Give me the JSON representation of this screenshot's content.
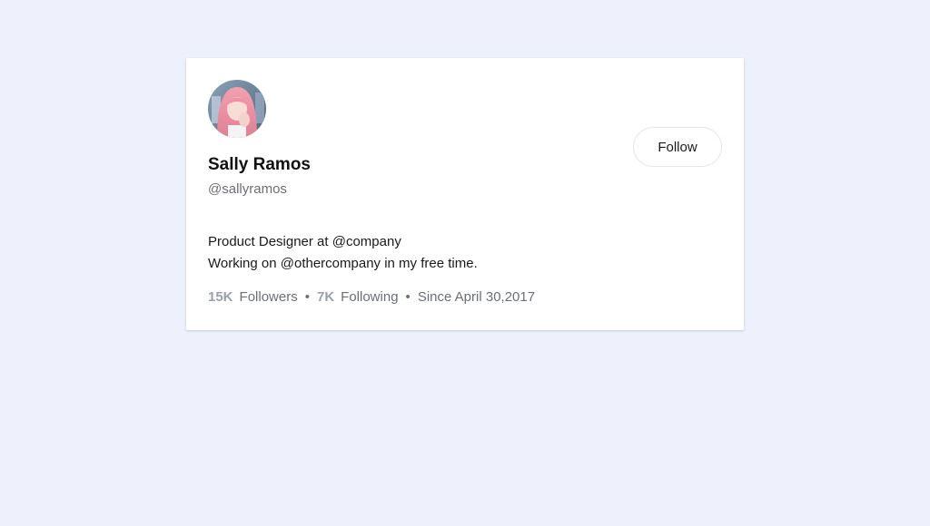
{
  "profile": {
    "avatar_alt": "Sally Ramos avatar",
    "name": "Sally Ramos",
    "handle": "@sallyramos",
    "follow_label": "Follow",
    "bio_line1": "Product Designer at @company",
    "bio_line2": "Working on @othercompany in my free time.",
    "followers_count": "15K",
    "followers_label": "Followers",
    "following_count": "7K",
    "following_label": "Following",
    "separator": "•",
    "since": "Since April 30,2017"
  },
  "colors": {
    "background": "#eef1fc",
    "card": "#ffffff",
    "name": "#111111",
    "muted": "#6b6f78",
    "stat_number": "#9aa0ab"
  }
}
